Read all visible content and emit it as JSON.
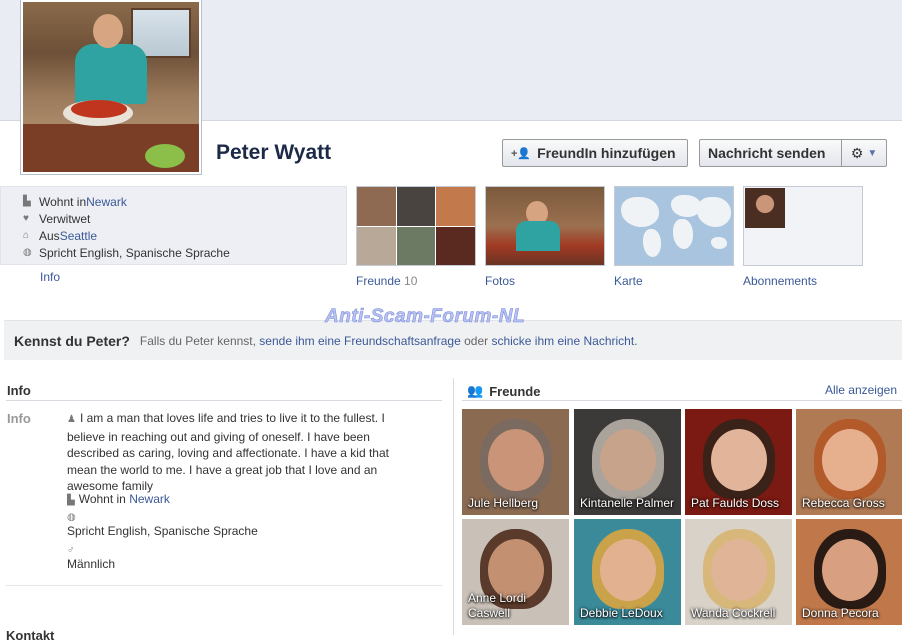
{
  "profile": {
    "name": "Peter Wyatt"
  },
  "actions": {
    "add_friend_label": "FreundIn hinzufügen",
    "message_label": "Nachricht senden",
    "add_friend_icon": "add-friend-icon",
    "gear_icon": "gear-icon"
  },
  "about_summary": {
    "lives_prefix": "Wohnt in ",
    "lives_city": "Newark",
    "status": "Verwitwet",
    "from_prefix": "Aus ",
    "from_city": "Seattle",
    "languages": "Spricht English, Spanische Sprache",
    "info_link": "Info"
  },
  "tiles": [
    {
      "label": "Freunde",
      "count": "10"
    },
    {
      "label": "Fotos",
      "count": ""
    },
    {
      "label": "Karte",
      "count": ""
    },
    {
      "label": "Abonnements",
      "count": ""
    }
  ],
  "watermark": "Anti-Scam-Forum-NL",
  "know_prompt": {
    "question": "Kennst du Peter?",
    "text_1": "Falls du Peter kennst, ",
    "link_1": "sende ihm eine Freundschaftsanfrage",
    "text_2": " oder ",
    "link_2": "schicke ihm eine Nachricht",
    "text_3": "."
  },
  "info_section": {
    "heading": "Info",
    "key": "Info",
    "bio": "I am a man that loves life and tries to live it to the fullest. I believe in reaching out and giving of oneself. I have been described as caring, loving and affectionate. I have a kid that mean the world to me. I have a great job that I love and an awesome family",
    "lives_prefix": "Wohnt in ",
    "lives_city": "Newark",
    "languages": "Spricht English, Spanische Sprache",
    "gender": "Männlich",
    "next_heading": "Kontakt"
  },
  "friends_section": {
    "heading": "Freunde",
    "see_all": "Alle anzeigen",
    "friends": [
      {
        "name": "Jule Hellberg",
        "bg": "#8b6a52",
        "face": "#c99478",
        "hair": "#7a6a60"
      },
      {
        "name": "Kintanelle Palmer",
        "bg": "#3c3a38",
        "face": "#c8a38c",
        "hair": "#a9a39b"
      },
      {
        "name": "Pat Faulds Doss",
        "bg": "#7a1a12",
        "face": "#e2b49a",
        "hair": "#3a2218"
      },
      {
        "name": "Rebecca Gross",
        "bg": "#b07a54",
        "face": "#e6b08f",
        "hair": "#b35a2b"
      },
      {
        "name": "Anne Lordi Caswell",
        "bg": "#c9c1b8",
        "face": "#c49072",
        "hair": "#5a3a2a"
      },
      {
        "name": "Debbie LeDoux",
        "bg": "#3a8a9a",
        "face": "#e2b290",
        "hair": "#c9a24a"
      },
      {
        "name": "Wanda Cockrell",
        "bg": "#d8d2c8",
        "face": "#e0b496",
        "hair": "#d8b87a"
      },
      {
        "name": "Donna Pecora",
        "bg": "#c0784a",
        "face": "#d8a080",
        "hair": "#2a1a14"
      }
    ]
  }
}
